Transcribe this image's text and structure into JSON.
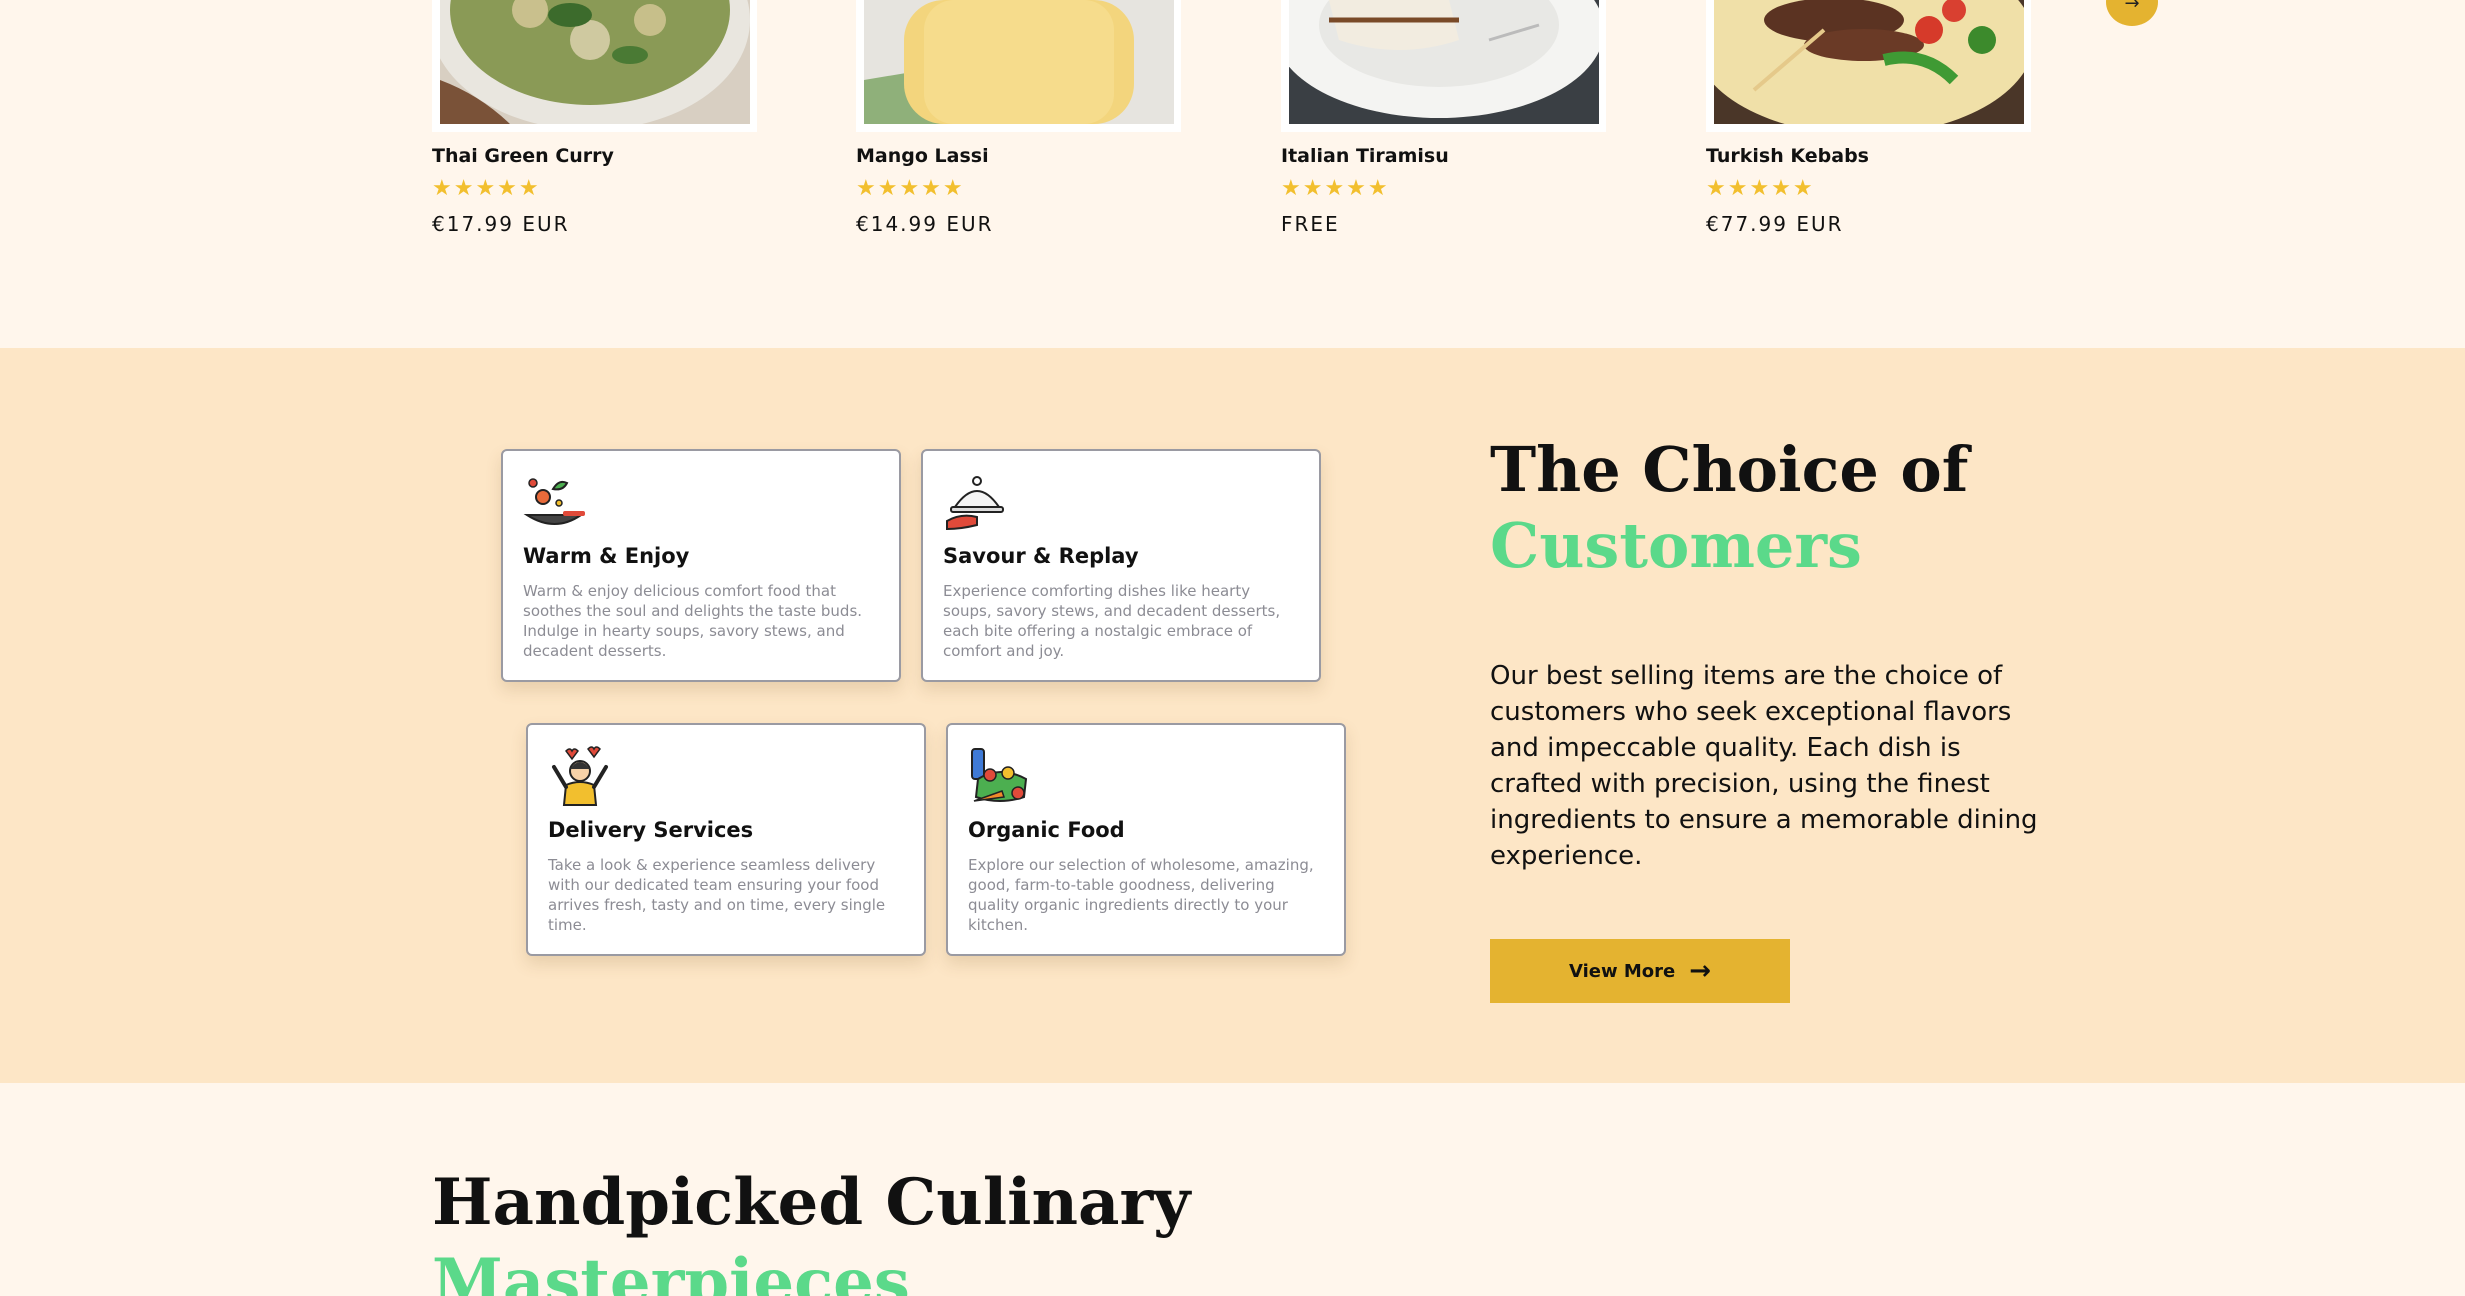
{
  "products": [
    {
      "name": "Thai Green Curry",
      "rating": 5,
      "stars": "★★★★★",
      "price": "€17.99 EUR"
    },
    {
      "name": "Mango Lassi",
      "rating": 5,
      "stars": "★★★★★",
      "price": "€14.99 EUR"
    },
    {
      "name": "Italian Tiramisu",
      "rating": 5,
      "stars": "★★★★★",
      "price": "FREE"
    },
    {
      "name": "Turkish Kebabs",
      "rating": 5,
      "stars": "★★★★★",
      "price": "€77.99 EUR"
    }
  ],
  "carousel": {
    "next_icon": "arrow-right-icon",
    "next_symbol": "→"
  },
  "features": [
    {
      "title": "Warm & Enjoy",
      "icon": "wok-icon",
      "description": "Warm & enjoy delicious comfort food that soothes the soul and delights the taste buds. Indulge in hearty soups, savory stews, and decadent desserts."
    },
    {
      "title": "Savour & Replay",
      "icon": "cloche-icon",
      "description": "Experience comforting dishes like hearty soups, savory stews, and decadent desserts, each bite offering a nostalgic embrace of comfort and joy."
    },
    {
      "title": "Delivery Services",
      "icon": "happy-person-icon",
      "description": "Take a look & experience seamless delivery with our dedicated team ensuring your food arrives fresh, tasty and on time, every single time."
    },
    {
      "title": "Organic Food",
      "icon": "groceries-icon",
      "description": "Explore our selection of wholesome, amazing, good, farm-to-table goodness, delivering quality organic ingredients directly to your kitchen."
    }
  ],
  "choice": {
    "title_line1": "The Choice of",
    "title_line2": "Customers",
    "description": "Our best selling items are the choice of customers who seek exceptional flavors and impeccable quality. Each dish is crafted with precision, using the finest ingredients to ensure a memorable dining experience.",
    "button_label": "View More",
    "button_arrow": "→"
  },
  "handpicked": {
    "title_line1": "Handpicked Culinary",
    "title_line2": "Masterpieces"
  },
  "colors": {
    "accent_yellow": "#e4b330",
    "accent_green": "#5bd98a",
    "star": "#f2bf2e",
    "section_bg": "#fde6c6",
    "page_bg": "#fff6ec"
  }
}
